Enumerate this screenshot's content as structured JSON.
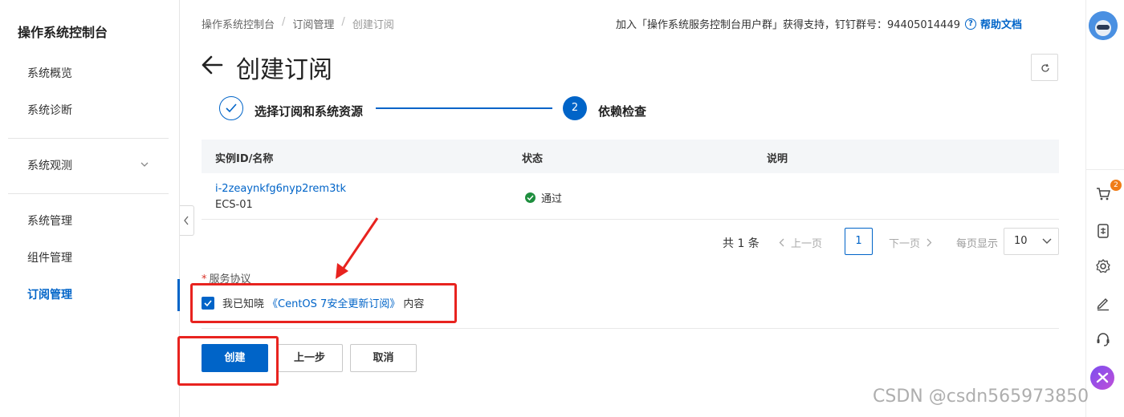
{
  "sidebar": {
    "title": "操作系统控制台",
    "items": [
      {
        "label": "系统概览"
      },
      {
        "label": "系统诊断"
      },
      {
        "label": "系统观测"
      },
      {
        "label": "系统管理"
      },
      {
        "label": "组件管理"
      },
      {
        "label": "订阅管理"
      }
    ]
  },
  "breadcrumb": [
    "操作系统控制台",
    "订阅管理",
    "创建订阅"
  ],
  "header": {
    "info": "加入「操作系统服务控制台用户群」获得支持，钉钉群号：94405014449",
    "help_label": "帮助文档",
    "help_icon": "?",
    "title": "创建订阅"
  },
  "steps": [
    {
      "label": "选择订阅和系统资源",
      "state": "done"
    },
    {
      "label": "依赖检查",
      "number": "2",
      "state": "current"
    }
  ],
  "table": {
    "columns": [
      "实例ID/名称",
      "状态",
      "说明"
    ],
    "rows": [
      {
        "instance_id": "i-2zeaynkfg6nyp2rem3tk",
        "instance_name": "ECS-01",
        "status": "通过",
        "note": ""
      }
    ]
  },
  "pagination": {
    "total_text": "共 1 条",
    "prev_label": "上一页",
    "current_page": "1",
    "next_label": "下一页",
    "page_size_label": "每页显示",
    "page_size": "10"
  },
  "agreement": {
    "required_mark": "*",
    "label": "服务协议",
    "checked": true,
    "prefix": "我已知晓",
    "link": "《CentOS 7安全更新订阅》",
    "suffix": "内容"
  },
  "buttons": {
    "create": "创建",
    "previous": "上一步",
    "cancel": "取消"
  },
  "right_rail": {
    "cart_badge": "2"
  },
  "watermark": "CSDN @csdn565973850",
  "colors": {
    "primary": "#0064c8",
    "success": "#1e8e3e",
    "annotation_red": "#e8231f",
    "badge_orange": "#f07c17"
  }
}
